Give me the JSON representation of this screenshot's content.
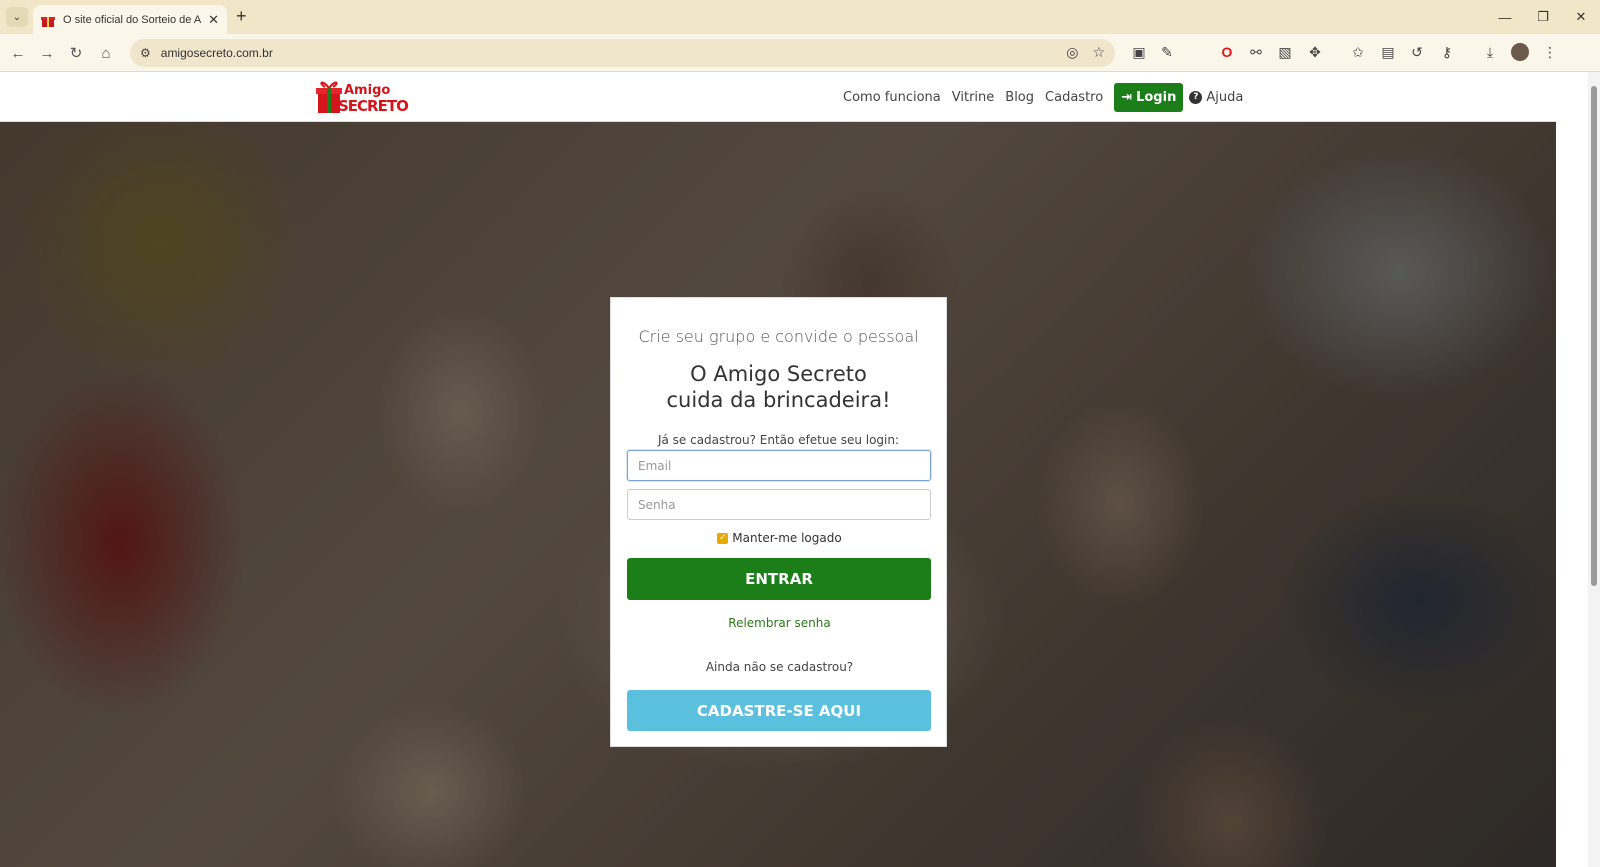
{
  "browser": {
    "tab_title": "O site oficial do Sorteio de Amigo Secreto",
    "url": "amigosecreto.com.br",
    "new_tab": "+",
    "tab_close": "✕"
  },
  "header": {
    "logo_line1": "Amigo",
    "logo_line2": "SECRETO",
    "nav": {
      "como_funciona": "Como funciona",
      "vitrine": "Vitrine",
      "blog": "Blog",
      "cadastro": "Cadastro",
      "login": "Login",
      "ajuda": "Ajuda"
    }
  },
  "card": {
    "subtitle": "Crie seu grupo e convide o pessoal",
    "title_line1": "O Amigo Secreto",
    "title_line2": "cuida da brincadeira!",
    "prompt": "Já se cadastrou? Então efetue seu login:",
    "email_placeholder": "Email",
    "senha_placeholder": "Senha",
    "keep_logged": "Manter-me logado",
    "keep_logged_checked": true,
    "submit": "ENTRAR",
    "forgot": "Relembrar senha",
    "not_registered": "Ainda não se cadastrou?",
    "register": "CADASTRE-SE AQUI"
  },
  "colors": {
    "primary_green": "#1b7e18",
    "info_blue": "#5bc0de",
    "logo_red": "#d5151b"
  }
}
